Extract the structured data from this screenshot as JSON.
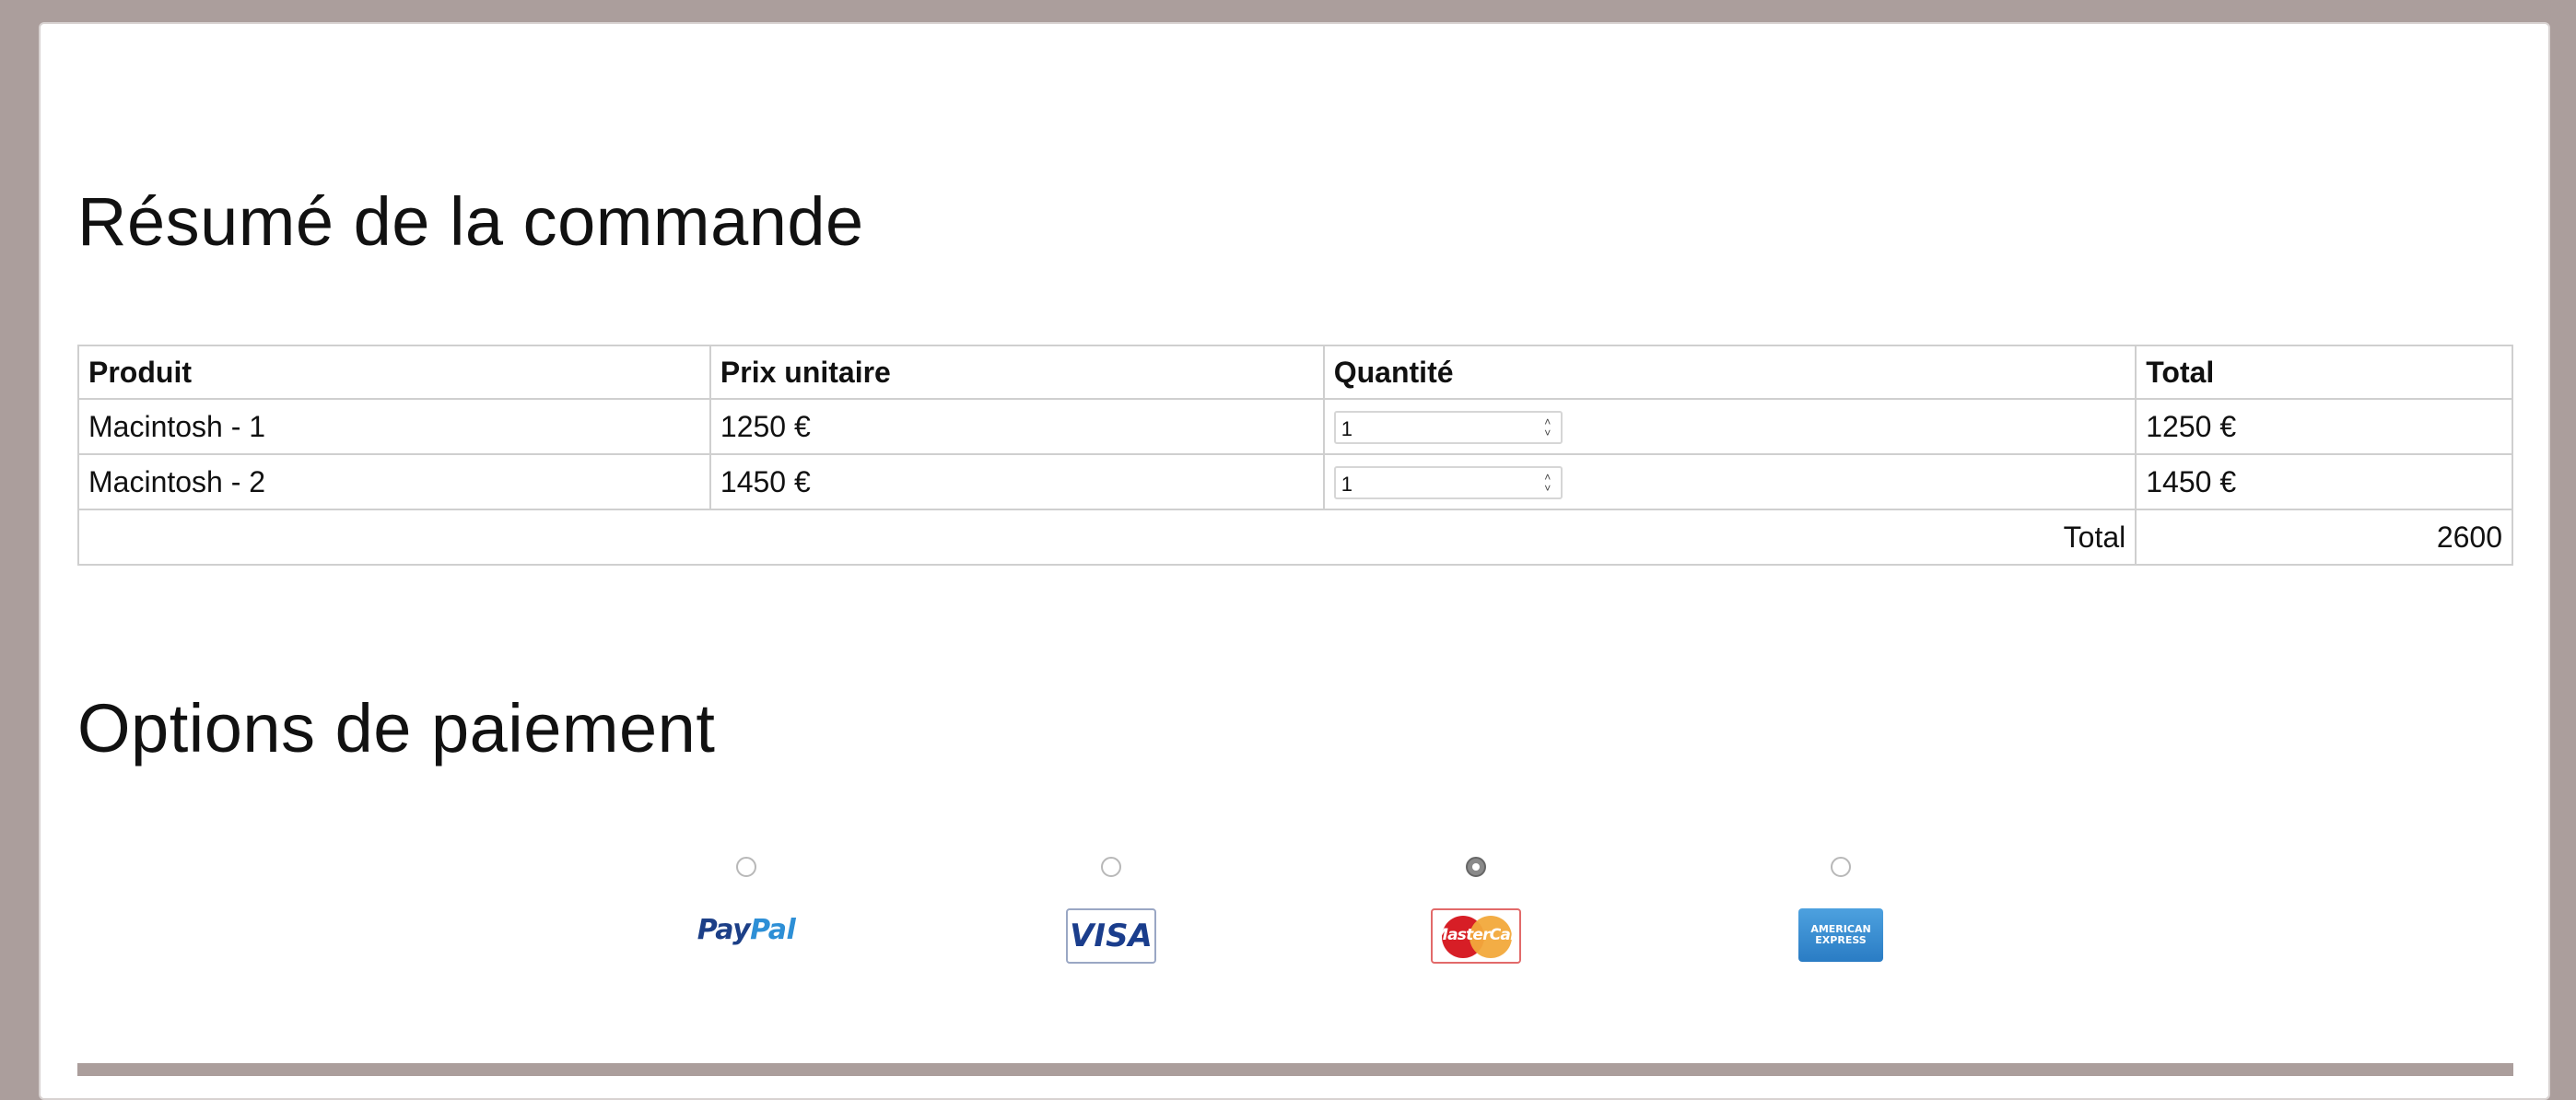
{
  "order_summary": {
    "title": "Résumé de la commande",
    "columns": [
      "Produit",
      "Prix unitaire",
      "Quantité",
      "Total"
    ],
    "rows": [
      {
        "product": "Macintosh - 1",
        "unit_price": "1250 €",
        "quantity": "1",
        "total": "1250 €"
      },
      {
        "product": "Macintosh - 2",
        "unit_price": "1450 €",
        "quantity": "1",
        "total": "1450 €"
      }
    ],
    "grand_total_label": "Total",
    "grand_total_value": "2600"
  },
  "payment": {
    "title": "Options de paiement",
    "options": [
      {
        "name": "PayPal",
        "logo_parts": [
          "Pay",
          "Pal"
        ],
        "selected": false
      },
      {
        "name": "VISA",
        "selected": false
      },
      {
        "name": "MasterCard",
        "selected": true
      },
      {
        "name": "AMERICAN EXPRESS",
        "logo_lines": [
          "AMERICAN",
          "EXPRESS"
        ],
        "selected": false
      }
    ]
  },
  "colors": {
    "background": "#ab9e9c",
    "panel": "#ffffff",
    "table_border": "#cfcfcf"
  },
  "icons": {
    "spinner_up": "chevron-up-icon",
    "spinner_down": "chevron-down-icon"
  }
}
